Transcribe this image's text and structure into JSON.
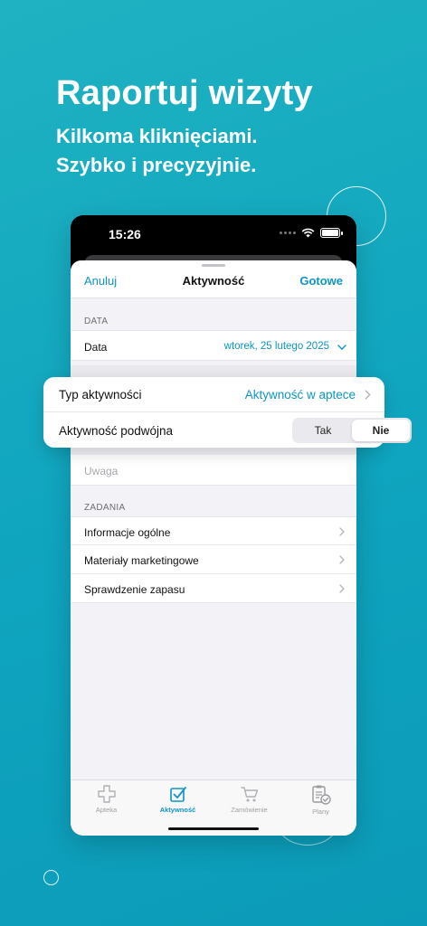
{
  "promo": {
    "headline": "Raportuj wizyty",
    "line1": "Kilkoma kliknięciami.",
    "line2": "Szybko i precyzyjnie."
  },
  "status_bar": {
    "time": "15:26"
  },
  "nav": {
    "cancel": "Anuluj",
    "title": "Aktywność",
    "done": "Gotowe"
  },
  "data_section": {
    "header": "DATA",
    "label": "Data",
    "value": "wtorek, 25 lutego 2025"
  },
  "activity_card": {
    "type_label": "Typ aktywności",
    "type_value": "Aktywność w aptece",
    "double_label": "Aktywność podwójna",
    "options": [
      "Tak",
      "Nie"
    ],
    "selected": "Nie"
  },
  "note_placeholder": "Uwaga",
  "tasks": {
    "header": "ZADANIA",
    "items": [
      "Informacje ogólne",
      "Materiały marketingowe",
      "Sprawdzenie zapasu"
    ]
  },
  "tabs": [
    {
      "label": "Apteka",
      "icon": "pharmacy-cross-icon"
    },
    {
      "label": "Aktywność",
      "icon": "checkbox-icon"
    },
    {
      "label": "Zamówienie",
      "icon": "cart-icon"
    },
    {
      "label": "Plany",
      "icon": "clipboard-check-icon"
    }
  ],
  "active_tab": "Aktywność",
  "colors": {
    "accent": "#0d95c4",
    "background": "#10a8c0"
  }
}
